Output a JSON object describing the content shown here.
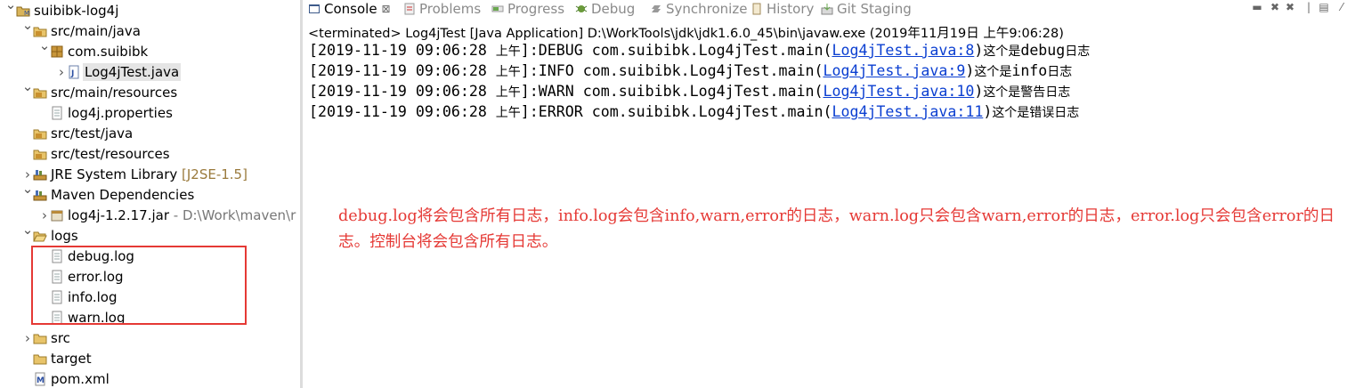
{
  "explorer": {
    "items": [
      {
        "label": "suibibk-log4j",
        "icon": "project-icon",
        "chevron": "expanded"
      },
      {
        "label": "src/main/java",
        "icon": "source-folder-icon",
        "chevron": "expanded"
      },
      {
        "label": "com.suibibk",
        "icon": "package-icon",
        "chevron": "expanded"
      },
      {
        "label": "Log4jTest.java",
        "icon": "java-file-icon",
        "chevron": "collapsed"
      },
      {
        "label": "src/main/resources",
        "icon": "source-folder-icon",
        "chevron": "expanded"
      },
      {
        "label": "log4j.properties",
        "icon": "file-icon",
        "chevron": "none"
      },
      {
        "label": "src/test/java",
        "icon": "source-folder-icon",
        "chevron": "none"
      },
      {
        "label": "src/test/resources",
        "icon": "source-folder-icon",
        "chevron": "none"
      },
      {
        "label": "JRE System Library",
        "decoration": "[J2SE-1.5]",
        "icon": "library-icon",
        "chevron": "collapsed"
      },
      {
        "label": "Maven Dependencies",
        "icon": "library-icon",
        "chevron": "expanded"
      },
      {
        "label": "log4j-1.2.17.jar",
        "path": "- D:\\Work\\maven\\r",
        "icon": "jar-icon",
        "chevron": "collapsed"
      },
      {
        "label": "logs",
        "icon": "folder-open-icon",
        "chevron": "expanded"
      },
      {
        "label": "debug.log",
        "icon": "file-icon",
        "chevron": "none"
      },
      {
        "label": "error.log",
        "icon": "file-icon",
        "chevron": "none"
      },
      {
        "label": "info.log",
        "icon": "file-icon",
        "chevron": "none"
      },
      {
        "label": "warn.log",
        "icon": "file-icon",
        "chevron": "none"
      },
      {
        "label": "src",
        "icon": "folder-icon",
        "chevron": "collapsed"
      },
      {
        "label": "target",
        "icon": "folder-icon",
        "chevron": "none"
      },
      {
        "label": "pom.xml",
        "icon": "xml-file-icon",
        "chevron": "none"
      }
    ]
  },
  "tabs": [
    {
      "label": "Console",
      "icon": "console-icon",
      "active": true,
      "close": "⊠"
    },
    {
      "label": "Problems",
      "icon": "problems-icon"
    },
    {
      "label": "Progress",
      "icon": "progress-icon"
    },
    {
      "label": "Debug",
      "icon": "debug-icon"
    },
    {
      "label": "Synchronize",
      "icon": "synchronize-icon"
    },
    {
      "label": "History",
      "icon": "history-icon"
    },
    {
      "label": "Git Staging",
      "icon": "git-staging-icon"
    }
  ],
  "console": {
    "status": "<terminated> Log4jTest [Java Application] D:\\WorkTools\\jdk\\jdk1.6.0_45\\bin\\javaw.exe (2019年11月19日 上午9:06:28)",
    "lines": [
      {
        "prefix": "[2019-11-19 09:06:28 ",
        "ampm": "上午",
        "mid": "]:DEBUG com.suibibk.Log4jTest.main(",
        "link": "Log4jTest.java:8",
        "close": ")",
        "msg_a": "这个是",
        "msg_b": "debug",
        "msg_c": "日志"
      },
      {
        "prefix": "[2019-11-19 09:06:28 ",
        "ampm": "上午",
        "mid": "]:INFO com.suibibk.Log4jTest.main(",
        "link": "Log4jTest.java:9",
        "close": ")",
        "msg_a": "这个是",
        "msg_b": "info",
        "msg_c": "日志"
      },
      {
        "prefix": "[2019-11-19 09:06:28 ",
        "ampm": "上午",
        "mid": "]:WARN com.suibibk.Log4jTest.main(",
        "link": "Log4jTest.java:10",
        "close": ")",
        "msg_a": "这个是警告日志",
        "msg_b": "",
        "msg_c": ""
      },
      {
        "prefix": "[2019-11-19 09:06:28 ",
        "ampm": "上午",
        "mid": "]:ERROR com.suibibk.Log4jTest.main(",
        "link": "Log4jTest.java:11",
        "close": ")",
        "msg_a": "这个是错误日志",
        "msg_b": "",
        "msg_c": ""
      }
    ]
  },
  "annotation": {
    "text": "debug.log将会包含所有日志，info.log会包含info,warn,error的日志，warn.log只会包含warn,error的日志，error.log只会包含error的日志。控制台将会包含所有日志。"
  },
  "colors": {
    "annotation": "#e53935",
    "link": "#0b3fd1",
    "highlight_box": "#e53935"
  }
}
